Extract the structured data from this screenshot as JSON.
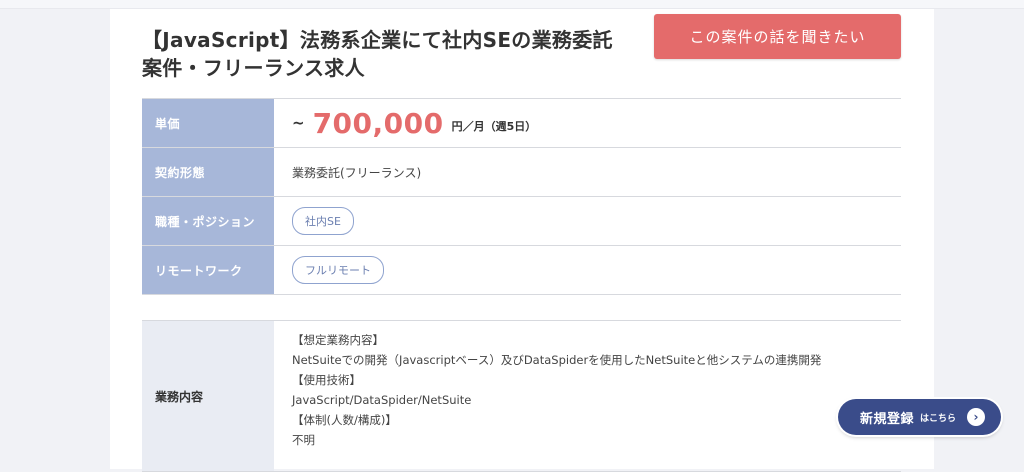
{
  "job": {
    "title": "【JavaScript】法務系企業にて社内SEの業務委託案件・フリーランス求人",
    "cta_label": "この案件の話を聞きたい"
  },
  "details": {
    "price": {
      "label": "単価",
      "prefix": "~",
      "value": "700,000",
      "unit": "円／月（週5日）"
    },
    "contract": {
      "label": "契約形態",
      "value": "業務委託(フリーランス)"
    },
    "position": {
      "label": "職種・ポジション",
      "tag": "社内SE"
    },
    "remote": {
      "label": "リモートワーク",
      "tag": "フルリモート"
    }
  },
  "work": {
    "label": "業務内容",
    "lines": [
      "【想定業務内容】",
      "NetSuiteでの開発（Javascriptベース）及びDataSpiderを使用したNetSuiteと他システムの連携開発",
      "【使用技術】",
      "JavaScript/DataSpider/NetSuite",
      "【体制(人数/構成)】",
      "不明"
    ]
  },
  "register_button": {
    "main": "新規登録",
    "sub": "はこちら",
    "icon": "chevron-right-icon"
  },
  "colors": {
    "accent_red": "#e46b6b",
    "label_blue": "#a7b7d9",
    "navy": "#3a4c8a"
  }
}
